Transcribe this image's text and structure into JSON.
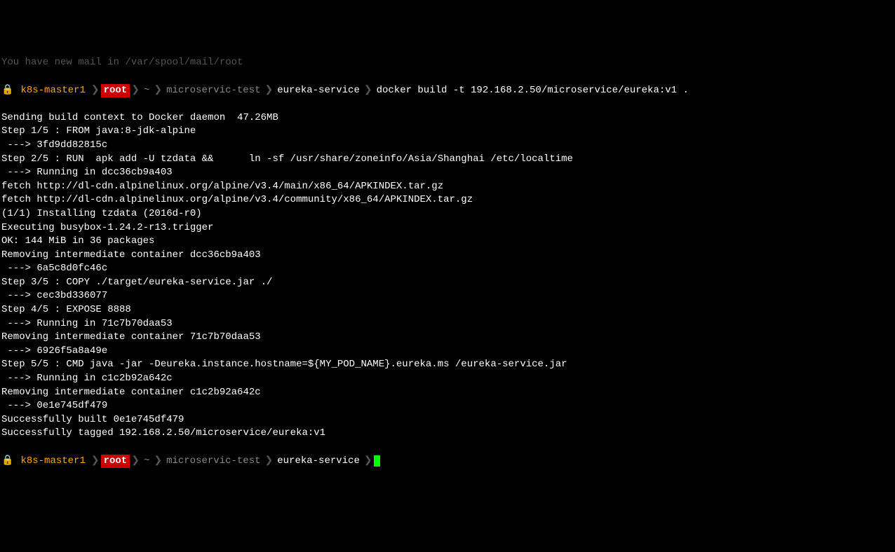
{
  "truncated_top": "You have new mail in /var/spool/mail/root",
  "prompt1": {
    "lock": "🔒",
    "host": "k8s-master1",
    "user": "root",
    "tilde": "~",
    "path1": "microservic-test",
    "path2": "eureka-service",
    "command": "docker build -t 192.168.2.50/microservice/eureka:v1 ."
  },
  "output": [
    "Sending build context to Docker daemon  47.26MB",
    "Step 1/5 : FROM java:8-jdk-alpine",
    " ---> 3fd9dd82815c",
    "Step 2/5 : RUN  apk add -U tzdata &&      ln -sf /usr/share/zoneinfo/Asia/Shanghai /etc/localtime",
    " ---> Running in dcc36cb9a403",
    "fetch http://dl-cdn.alpinelinux.org/alpine/v3.4/main/x86_64/APKINDEX.tar.gz",
    "fetch http://dl-cdn.alpinelinux.org/alpine/v3.4/community/x86_64/APKINDEX.tar.gz",
    "(1/1) Installing tzdata (2016d-r0)",
    "Executing busybox-1.24.2-r13.trigger",
    "OK: 144 MiB in 36 packages",
    "Removing intermediate container dcc36cb9a403",
    " ---> 6a5c8d0fc46c",
    "Step 3/5 : COPY ./target/eureka-service.jar ./",
    " ---> cec3bd336077",
    "Step 4/5 : EXPOSE 8888",
    " ---> Running in 71c7b70daa53",
    "Removing intermediate container 71c7b70daa53",
    " ---> 6926f5a8a49e",
    "Step 5/5 : CMD java -jar -Deureka.instance.hostname=${MY_POD_NAME}.eureka.ms /eureka-service.jar",
    " ---> Running in c1c2b92a642c",
    "Removing intermediate container c1c2b92a642c",
    " ---> 0e1e745df479",
    "Successfully built 0e1e745df479",
    "Successfully tagged 192.168.2.50/microservice/eureka:v1"
  ],
  "prompt2": {
    "lock": "🔒",
    "host": "k8s-master1",
    "user": "root",
    "tilde": "~",
    "path1": "microservic-test",
    "path2": "eureka-service"
  }
}
